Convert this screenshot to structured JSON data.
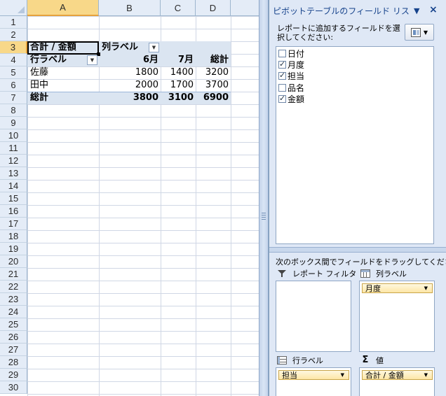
{
  "sheet": {
    "columns": [
      "A",
      "B",
      "C",
      "D"
    ],
    "rows": [
      "1",
      "2",
      "3",
      "4",
      "5",
      "6",
      "7",
      "8",
      "9",
      "10",
      "11",
      "12",
      "13",
      "14",
      "15",
      "16",
      "17",
      "18",
      "19",
      "20",
      "21",
      "22",
      "23",
      "24",
      "25",
      "26",
      "27",
      "28",
      "29",
      "30"
    ],
    "pivot": {
      "data_field_label": "合計 / 金額",
      "col_label_header": "列ラベル",
      "row_label_header": "行ラベル",
      "col_headers": [
        "6月",
        "7月",
        "総計"
      ],
      "rows": [
        {
          "label": "佐藤",
          "values": [
            "1800",
            "1400",
            "3200"
          ]
        },
        {
          "label": "田中",
          "values": [
            "2000",
            "1700",
            "3700"
          ]
        }
      ],
      "total": {
        "label": "総計",
        "values": [
          "3800",
          "3100",
          "6900"
        ]
      }
    }
  },
  "pane": {
    "title": "ピボットテーブルのフィールド リス",
    "dropdown_glyph": "▼",
    "close_glyph": "×",
    "instruction": "レポートに追加するフィールドを選択してください:",
    "fields": [
      {
        "label": "日付",
        "checked": false
      },
      {
        "label": "月度",
        "checked": true
      },
      {
        "label": "担当",
        "checked": true
      },
      {
        "label": "品名",
        "checked": false
      },
      {
        "label": "金額",
        "checked": true
      }
    ],
    "drag_instruction": "次のボックス間でフィールドをドラッグしてください:",
    "areas": {
      "filter": {
        "label": "レポート フィルタ",
        "items": []
      },
      "columns": {
        "label": "列ラベル",
        "items": [
          "月度"
        ]
      },
      "rows": {
        "label": "行ラベル",
        "items": [
          "担当"
        ]
      },
      "values": {
        "label": "値",
        "items": [
          "合計 / 金額"
        ]
      }
    }
  },
  "colors": {
    "header_bg": "#e4ecf7",
    "selected_header": "#f8d889",
    "pivot_band": "#dbe5f1",
    "pane_bg": "#dfe8f6",
    "pane_title": "#15428b",
    "chip_bg": "#fde6a6"
  },
  "icons": [
    "filter-icon",
    "column-labels-icon",
    "row-labels-icon",
    "sigma-icon",
    "layout-icon",
    "chevron-down-icon",
    "close-icon"
  ]
}
